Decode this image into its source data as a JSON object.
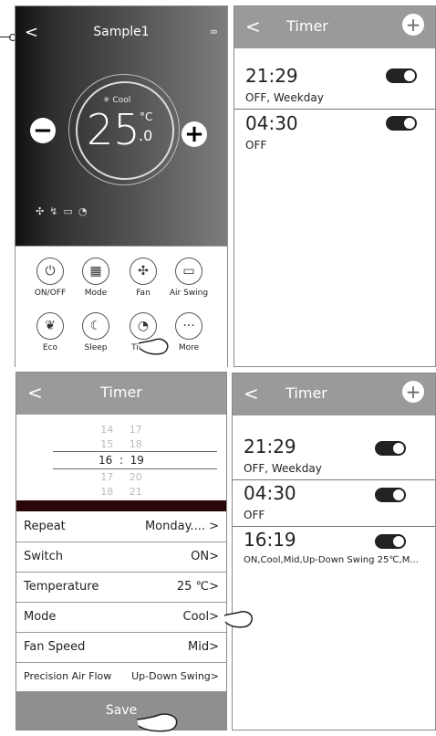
{
  "home": {
    "header": {
      "back": "<",
      "title": "Sample1",
      "more": "∞"
    },
    "mode": "Cool",
    "temperature": "25",
    "temperature_decimal": ".0",
    "unit": "°C",
    "minus": "−",
    "plus": "+",
    "buttons": [
      {
        "label": "ON/OFF",
        "icon": "power-icon"
      },
      {
        "label": "Mode",
        "icon": "grid-icon"
      },
      {
        "label": "Fan",
        "icon": "fan-icon"
      },
      {
        "label": "Air Swing",
        "icon": "swing-icon"
      },
      {
        "label": "Eco",
        "icon": "eco-icon"
      },
      {
        "label": "Sleep",
        "icon": "sleep-icon"
      },
      {
        "label": "Timer",
        "icon": "timer-icon"
      },
      {
        "label": "More",
        "icon": "more-icon"
      }
    ]
  },
  "timer_list": {
    "header": {
      "back": "<",
      "title": "Timer",
      "plus": "+"
    },
    "items": [
      {
        "time": "21:29",
        "sub": "OFF, Weekday"
      },
      {
        "time": "04:30",
        "sub": "OFF"
      }
    ]
  },
  "timer_edit": {
    "header": {
      "back": "<",
      "title": "Timer"
    },
    "picker": [
      {
        "h": "14",
        "m": "17"
      },
      {
        "h": "15",
        "m": "18"
      },
      {
        "h": "16",
        "m": "19"
      },
      {
        "h": "17",
        "m": "20"
      },
      {
        "h": "18",
        "m": "21"
      }
    ],
    "colon": ":",
    "rows": [
      {
        "label": "Repeat",
        "value": "Monday.... >"
      },
      {
        "label": "Switch",
        "value": "ON>"
      },
      {
        "label": "Temperature",
        "value": "25 ℃>"
      },
      {
        "label": "Mode",
        "value": "Cool>"
      },
      {
        "label": "Fan Speed",
        "value": "Mid>"
      },
      {
        "label": "Precision Air Flow",
        "value": "Up-Down Swing>"
      }
    ],
    "save": "Save"
  },
  "timer_list2": {
    "header": {
      "back": "<",
      "title": "Timer",
      "plus": "+"
    },
    "items": [
      {
        "time": "21:29",
        "sub": "OFF, Weekday"
      },
      {
        "time": "04:30",
        "sub": "OFF"
      },
      {
        "time": "16:19",
        "sub": "ON,Cool,Mid,Up-Down Swing 25℃,M..."
      }
    ]
  }
}
